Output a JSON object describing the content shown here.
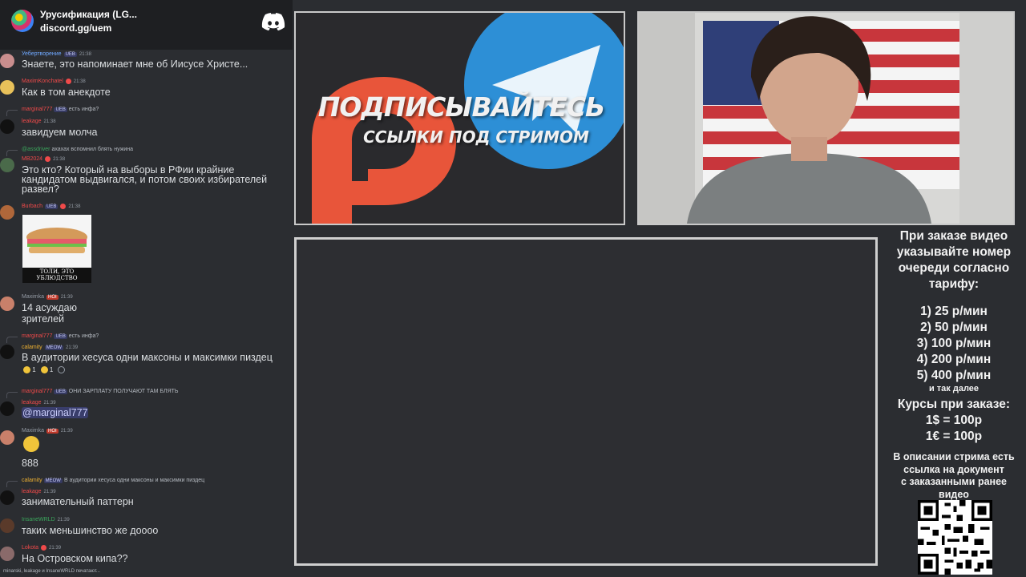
{
  "chat": {
    "server_name": "Урусификация (LG...",
    "server_invite": "discord.gg/uem",
    "messages": [
      {
        "user": "Уебертворение",
        "tag": "UEB",
        "time": "21:38",
        "text": "Знаете, это напоминает мне об Иисусе Христе..."
      },
      {
        "user": "MaximKonchatel",
        "time": "21:38",
        "text": "Как в том анекдоте"
      },
      {
        "reply_user": "marginal777",
        "reply_tag": "UEB",
        "reply_text": "есть инфа?",
        "user": "leakage",
        "time": "21:38",
        "text": "завидуем молча"
      },
      {
        "reply_user": "@assdriver",
        "reply_text": "ахахах вспомнил блять нужина",
        "user": "MB2024",
        "time": "21:38",
        "text_lines": [
          "Это кто? Который на выборы в РФии крайние",
          "кандидатом выдвигался, и потом своих избирателей",
          "развел?"
        ]
      },
      {
        "user": "Burbach",
        "tag": "UEB",
        "time": "21:38",
        "image_caption": "ТОЛИ, ЭТО УБЛЮДСТВО"
      },
      {
        "user": "Maximka",
        "tag": "HOI",
        "time": "21:39",
        "text_lines": [
          "14 асуждаю",
          "зрителей"
        ]
      },
      {
        "reply_user": "marginal777",
        "reply_tag": "UEB",
        "reply_text": "есть инфа?",
        "user": "calamity",
        "tag": "MEOW",
        "time": "21:39",
        "text": "В аудитории хесуса одни максоны и максимки пиздец",
        "reactions": [
          "1",
          "1"
        ]
      },
      {
        "reply_user": "marginal777",
        "reply_tag": "UEB",
        "reply_text": "ОНИ ЗАРПЛАТУ ПОЛУЧАЮТ ТАМ БЛЯТЬ",
        "user": "leakage",
        "time": "21:39",
        "mention": "@marginal777"
      },
      {
        "user": "Maximka",
        "tag": "HOI",
        "time": "21:39",
        "text": "888"
      },
      {
        "reply_user": "calamity",
        "reply_tag": "MEOW",
        "reply_text": "В аудитории хесуса одни максоны и максимки пиздец",
        "user": "leakage",
        "time": "21:39",
        "text": "занимательный паттерн"
      },
      {
        "user": "InsaneWRLD",
        "time": "21:39",
        "text": "таких меньшинство же доооо"
      },
      {
        "user": "Lokota",
        "time": "21:39",
        "text": "На Островском кипа??"
      }
    ],
    "typing": "minarski, leakage и InsaneWRLD печатают..."
  },
  "banner": {
    "title": "ПОДПИСЫВАЙТЕСЬ",
    "subtitle": "ССЫЛКИ ПОД СТРИМОМ"
  },
  "info": {
    "heading_lines": [
      "При заказе видео",
      "указывайте номер",
      "очереди согласно",
      "тарифу:"
    ],
    "tariffs": [
      "1) 25 р/мин",
      "2) 50 р/мин",
      "3) 100 р/мин",
      "4) 200 р/мин",
      "5) 400 р/мин"
    ],
    "tariff_more": "и так далее",
    "rates_heading": "Курсы при заказе:",
    "rates": [
      "1$ = 100р",
      "1€ = 100р"
    ],
    "doc_note_lines": [
      "В описании стрима есть",
      "ссылка на документ",
      "с заказанными ранее",
      "видео"
    ]
  },
  "colors": {
    "chat_bg": "#2b2d31",
    "header_bg": "#1e1f22",
    "patreon": "#e8553a",
    "telegram": "#2d8fd6",
    "username_red": "#f04a4a",
    "username_blue": "#6fa8ff",
    "username_green": "#3ba55c",
    "username_gold": "#f0b232"
  }
}
